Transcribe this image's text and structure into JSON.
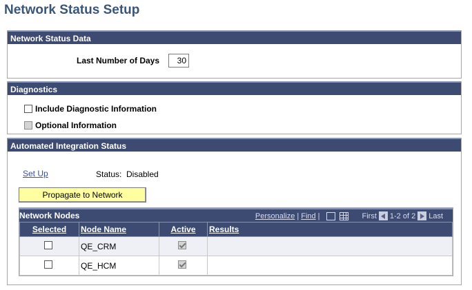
{
  "page": {
    "title": "Network Status Setup"
  },
  "network_status_data": {
    "header": "Network Status Data",
    "last_days_label": "Last Number of Days",
    "last_days_value": "30"
  },
  "diagnostics": {
    "header": "Diagnostics",
    "include_diag_label": "Include Diagnostic Information",
    "include_diag_checked": false,
    "optional_label": "Optional Information",
    "optional_checked": false
  },
  "integration": {
    "header": "Automated Integration Status",
    "setup_link": "Set Up",
    "status_label": "Status:",
    "status_value": "Disabled",
    "propagate_label": "Propagate to Network"
  },
  "grid": {
    "title": "Network Nodes",
    "personalize": "Personalize",
    "find": "Find",
    "first": "First",
    "range": "1-2 of 2",
    "last": "Last",
    "columns": [
      "Selected",
      "Node Name",
      "Active",
      "Results"
    ],
    "rows": [
      {
        "node": "QE_CRM",
        "selected": false,
        "active": true,
        "results": ""
      },
      {
        "node": "QE_HCM",
        "selected": false,
        "active": true,
        "results": ""
      }
    ]
  }
}
